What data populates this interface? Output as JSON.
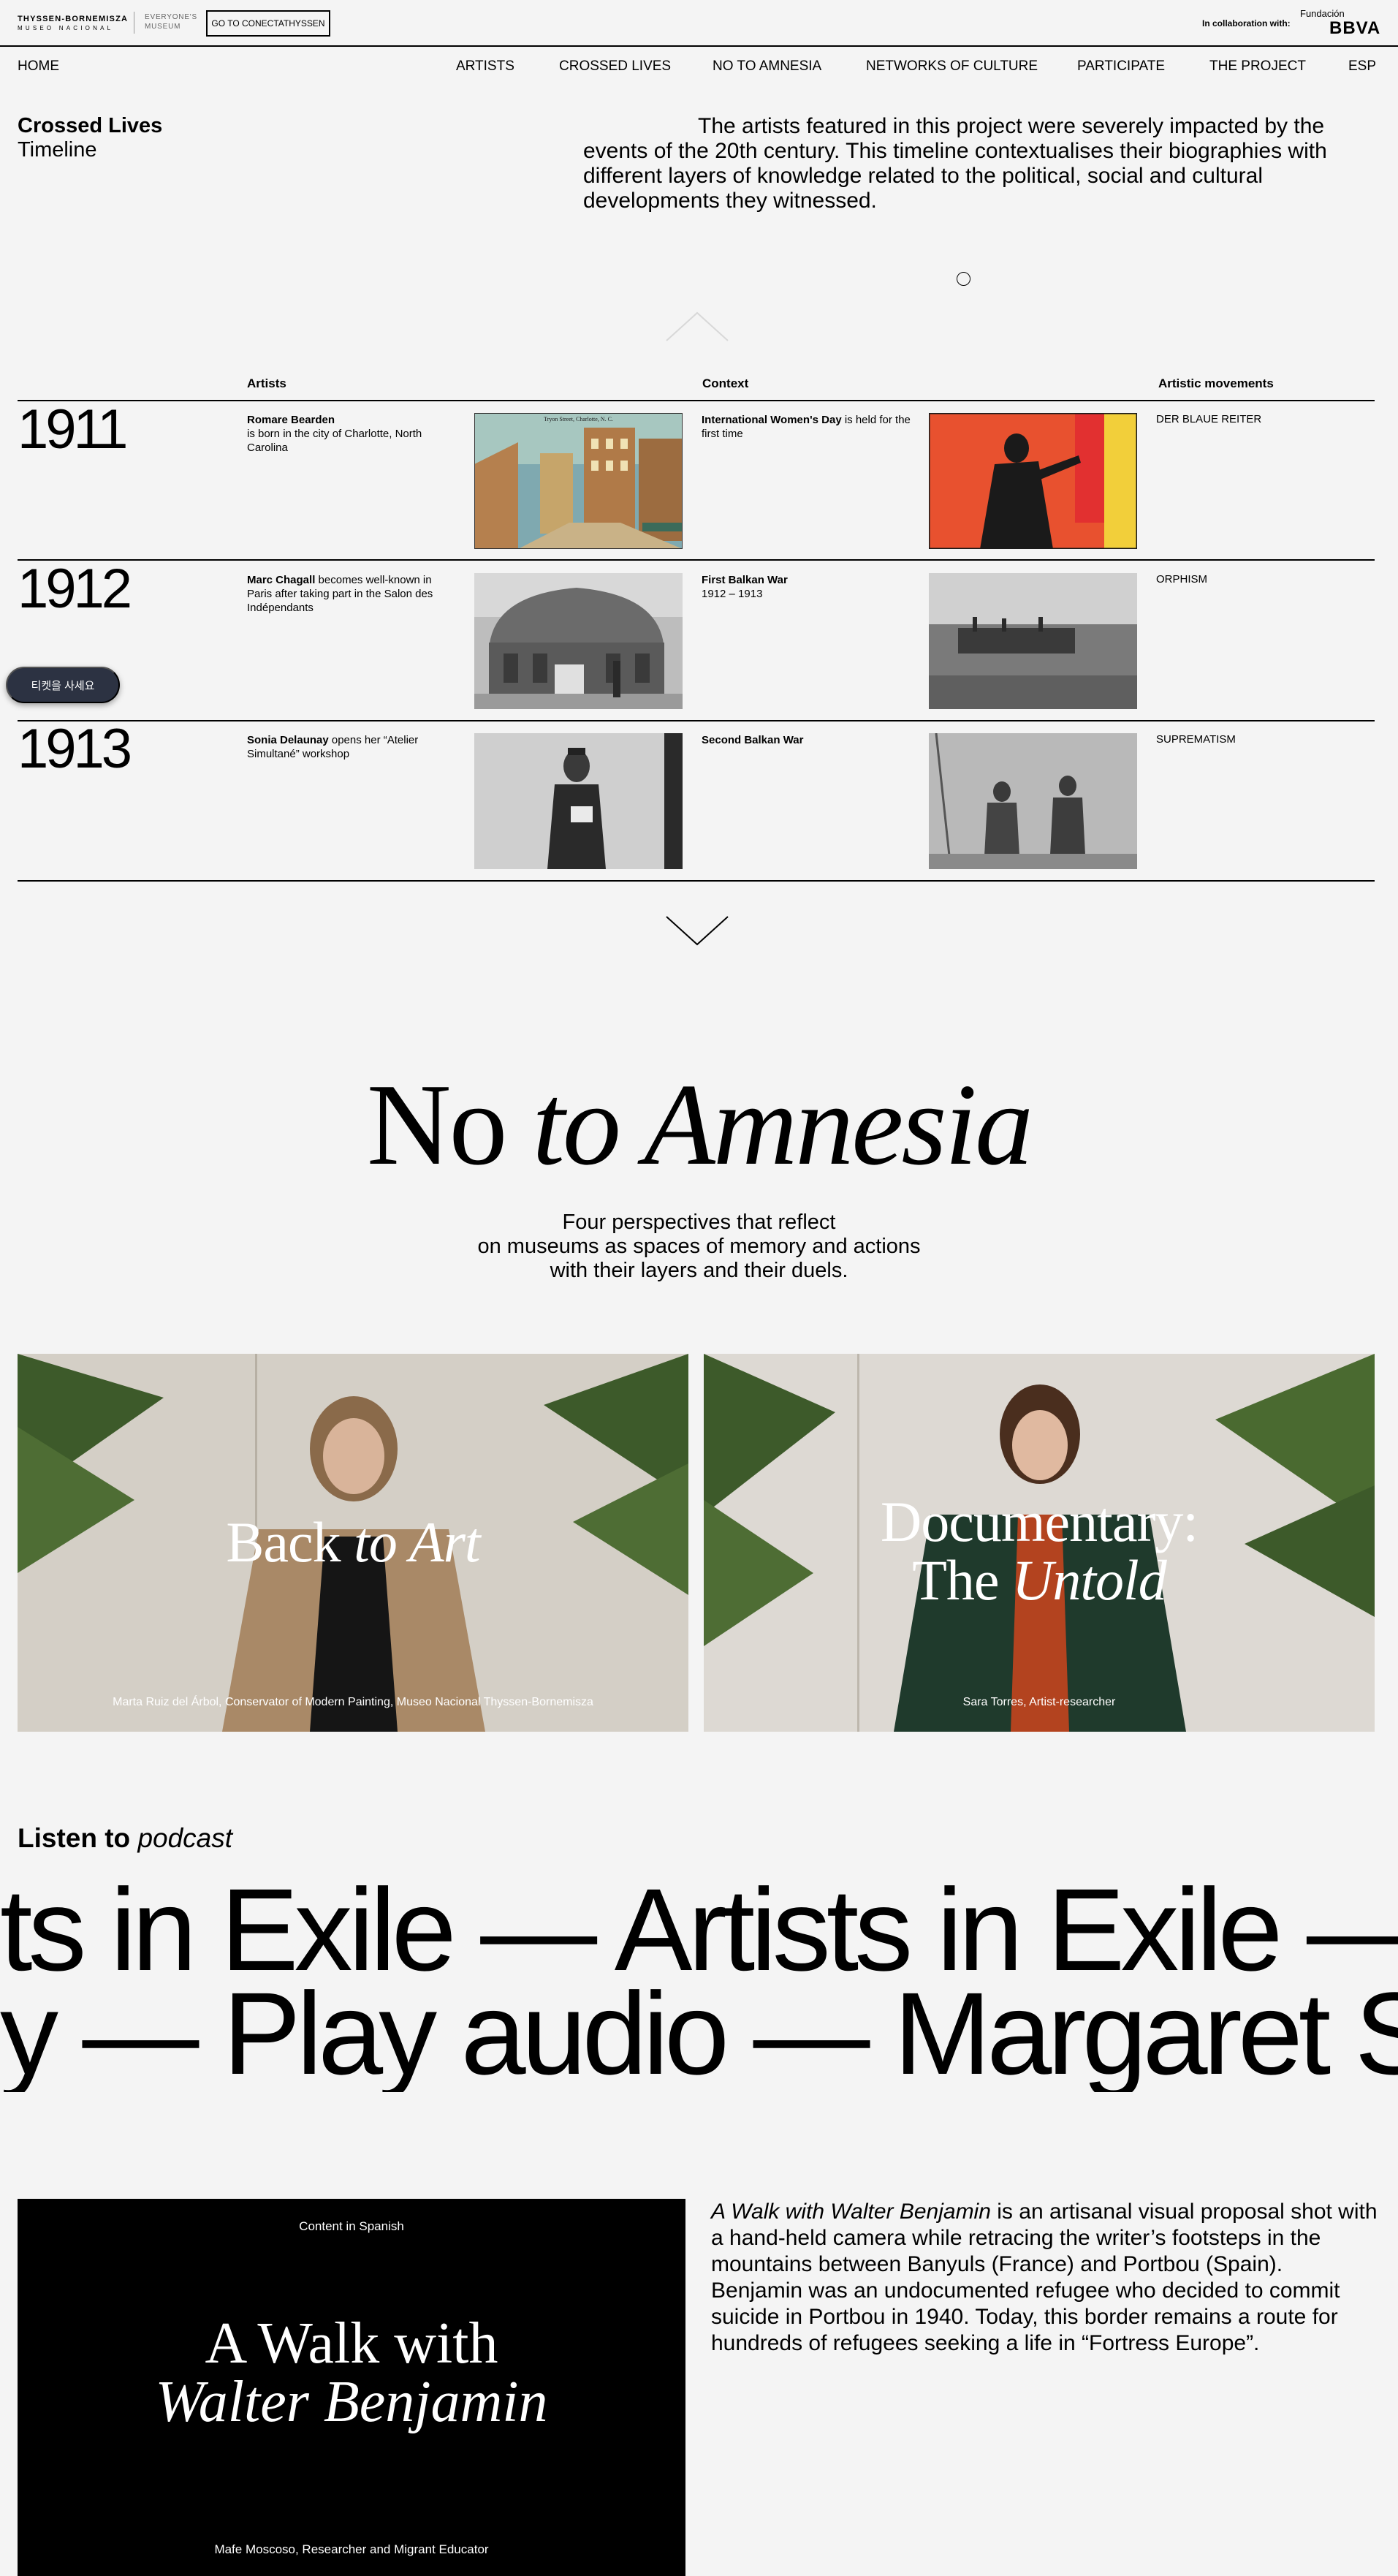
{
  "header": {
    "logo_line1": "THYSSEN-BORNEMISZA",
    "logo_line2": "MUSEO NACIONAL",
    "everyone_line1": "EVERYONE'S",
    "everyone_line2": "MUSEUM",
    "goto_button": "GO TO CONECTATHYSSEN",
    "collab_label": "In collaboration with:",
    "fundacion": "Fundación",
    "bbva": "BBVA"
  },
  "nav": {
    "home": "HOME",
    "items": [
      "ARTISTS",
      "CROSSED LIVES",
      "NO TO AMNESIA",
      "NETWORKS OF CULTURE",
      "PARTICIPATE",
      "THE PROJECT",
      "ESP"
    ]
  },
  "intro": {
    "title": "Crossed Lives",
    "subtitle": "Timeline",
    "text": "The artists featured in this project were severely impacted by the events of the 20th century. This timeline contextualises their biographies with different layers of knowledge related to the political, social and cultural developments they witnessed."
  },
  "timeline": {
    "headers": {
      "artists": "Artists",
      "context": "Context",
      "movements": "Artistic movements"
    },
    "rows": [
      {
        "year": "1911",
        "artist_bold": "Romare Bearden",
        "artist_text": "is born in the city of Charlotte, North Carolina",
        "context_bold": "International Women's Day",
        "context_text": " is held for the first time",
        "movement": "DER BLAUE REITER"
      },
      {
        "year": "1912",
        "artist_bold": "Marc Chagall",
        "artist_text": " becomes well-known in Paris after taking part in the Salon des Indépendants",
        "context_bold": "First Balkan War",
        "context_text": "1912 – 1913",
        "movement": "ORPHISM"
      },
      {
        "year": "1913",
        "artist_bold": "Sonia Delaunay",
        "artist_text": " opens her “Atelier Simultané” workshop",
        "context_bold": "Second Balkan War",
        "context_text": "",
        "movement": "SUPREMATISM"
      }
    ],
    "postcard_caption": "Tryon Street, Charlotte, N. C."
  },
  "ticket_button": "티켓을 사세요",
  "amnesia": {
    "title_plain": "No",
    "title_italic": "to Amnesia",
    "line1": "Four perspectives that reflect",
    "line2": "on museums as spaces of memory and actions",
    "line3": "with their layers and their duels.",
    "cards": [
      {
        "title_plain": "Back",
        "title_italic": "to Art",
        "caption": "Marta Ruiz del Árbol, Conservator of Modern Painting, Museo Nacional Thyssen-Bornemisza"
      },
      {
        "title_line1": "Documentary:",
        "title_plain": "The",
        "title_italic": "Untold",
        "caption": "Sara Torres, Artist-researcher"
      }
    ]
  },
  "podcast": {
    "listen_plain": "Listen to",
    "listen_italic": "podcast",
    "marquee1": "ts in Exile — Artists in Exile — Artis",
    "marquee2": "y — Play audio — Margaret Scola"
  },
  "walk": {
    "spanish": "Content in Spanish",
    "title_line1": "A Walk with",
    "title_line2": "Walter Benjamin",
    "caption": "Mafe Moscoso, Researcher and Migrant Educator",
    "desc_italic": "A Walk with Walter Benjamin",
    "desc_text": " is an artisanal visual proposal shot with a hand-held camera while retracing the writer’s footsteps in the mountains between Banyuls (France) and Portbou (Spain). Benjamin was an undocumented refugee who decided to commit suicide in Portbou in 1940. Today, this border remains a route for hundreds of refugees seeking a life in “Fortress Europe”."
  }
}
